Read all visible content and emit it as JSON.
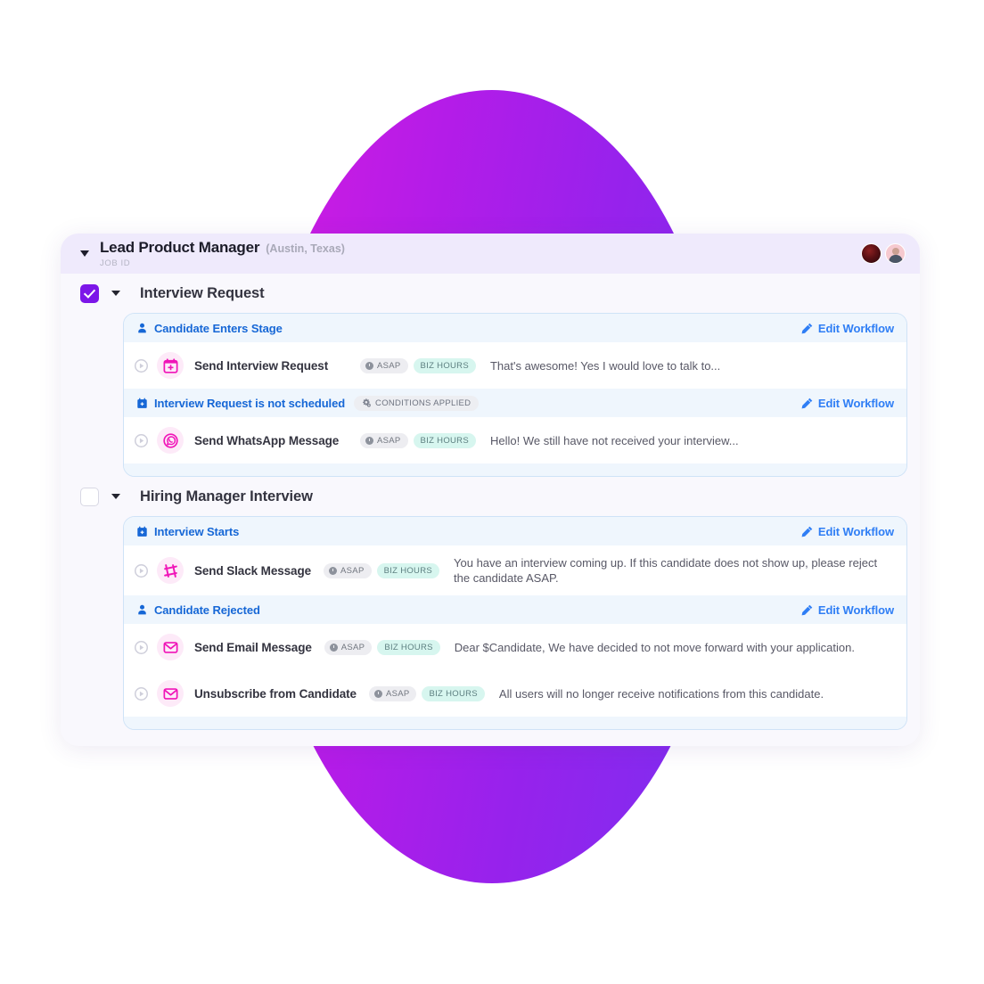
{
  "job": {
    "title": "Lead Product Manager",
    "location": "(Austin, Texas)",
    "job_id_label": "JOB ID",
    "collapse_icon": "caret-down-icon",
    "avatars": [
      "avatar-user-1",
      "avatar-user-2"
    ]
  },
  "badges": {
    "asap": "ASAP",
    "biz_hours": "BIZ HOURS",
    "conditions_applied": "CONDITIONS APPLIED"
  },
  "edit_workflow_label": "Edit Workflow",
  "colors": {
    "accent_purple": "#7c16e8",
    "link_blue": "#2f7ef5",
    "trigger_blue": "#1667d6",
    "icon_pink": "#f015b8",
    "badge_mint": "#d7f6ef",
    "card_bg": "#f9f8fd",
    "header_bg": "#efeafc"
  },
  "stages": [
    {
      "title": "Interview Request",
      "checked": true,
      "checkbox_name": "stage-checkbox-interview-request",
      "workflows": [
        {
          "trigger": "Candidate Enters Stage",
          "trigger_icon": "person-icon",
          "conditions": null,
          "actions": [
            {
              "name": "Send Interview Request",
              "icon": "calendar-plus-icon",
              "message": "That's awesome! Yes I would love to talk to..."
            }
          ]
        },
        {
          "trigger": "Interview Request is not scheduled",
          "trigger_icon": "calendar-icon",
          "conditions": "CONDITIONS APPLIED",
          "actions": [
            {
              "name": "Send WhatsApp Message",
              "icon": "whatsapp-icon",
              "message": "Hello! We still have not received your interview..."
            }
          ]
        }
      ]
    },
    {
      "title": "Hiring Manager Interview",
      "checked": false,
      "checkbox_name": "stage-checkbox-hiring-manager-interview",
      "workflows": [
        {
          "trigger": "Interview Starts",
          "trigger_icon": "calendar-icon",
          "conditions": null,
          "actions": [
            {
              "name": "Send Slack Message",
              "icon": "slack-icon",
              "message": "You have an interview coming up. If this candidate does not show up, please reject the candidate ASAP."
            }
          ]
        },
        {
          "trigger": "Candidate Rejected",
          "trigger_icon": "person-icon",
          "conditions": null,
          "actions": [
            {
              "name": "Send Email Message",
              "icon": "envelope-icon",
              "message": "Dear $Candidate, We have decided to not move forward with your application."
            },
            {
              "name": "Unsubscribe from Candidate",
              "icon": "envelope-icon",
              "message": "All users will no longer receive notifications from this candidate."
            }
          ]
        }
      ]
    }
  ]
}
